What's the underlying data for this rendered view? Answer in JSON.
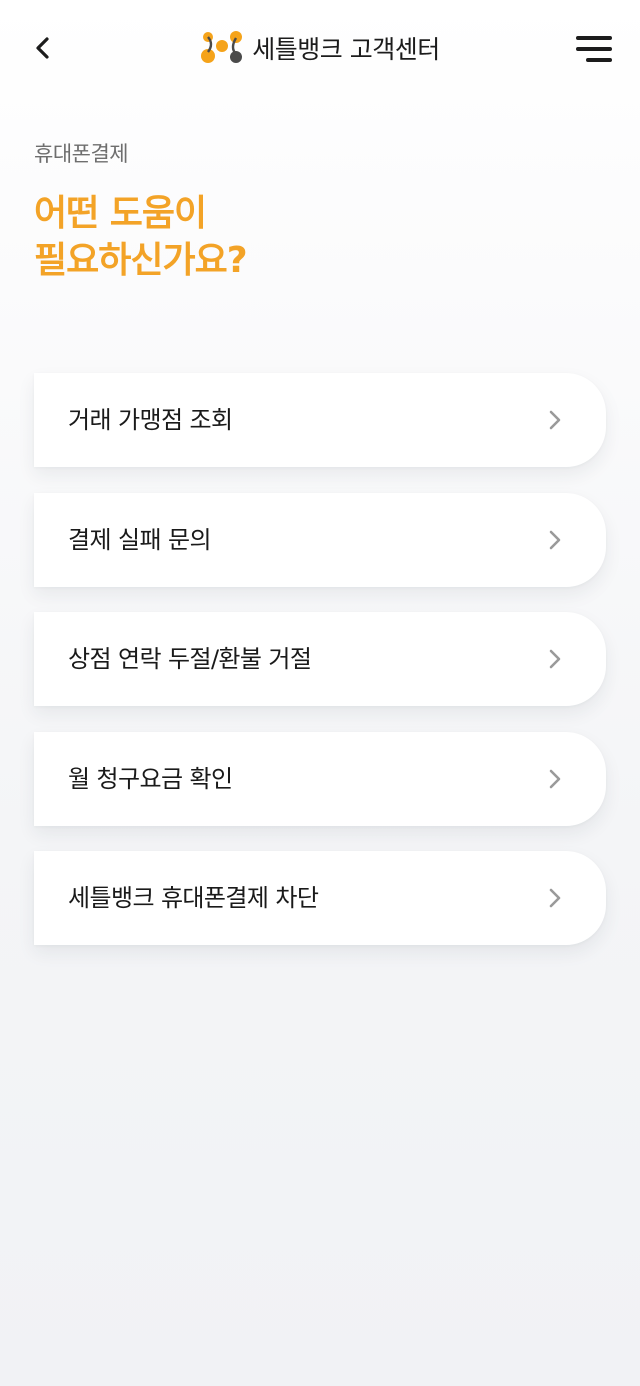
{
  "header": {
    "title": "세틀뱅크 고객센터",
    "back_icon": "chevron-left-icon",
    "menu_icon": "hamburger-menu-icon",
    "logo_colors": {
      "orange": "#f5a31a",
      "gray": "#4a4a4a"
    }
  },
  "breadcrumb": "휴대폰결제",
  "headline": {
    "line1": "어떤 도움이",
    "line2": "필요하신가요?",
    "color": "#f3a327"
  },
  "menu": {
    "items": [
      {
        "label": "거래 가맹점 조회"
      },
      {
        "label": "결제 실패 문의"
      },
      {
        "label": "상점 연락 두절/환불 거절"
      },
      {
        "label": "월 청구요금 확인"
      },
      {
        "label": "세틀뱅크 휴대폰결제 차단"
      }
    ],
    "chevron_icon": "chevron-right-icon",
    "chevron_color": "#9a9a9a"
  }
}
